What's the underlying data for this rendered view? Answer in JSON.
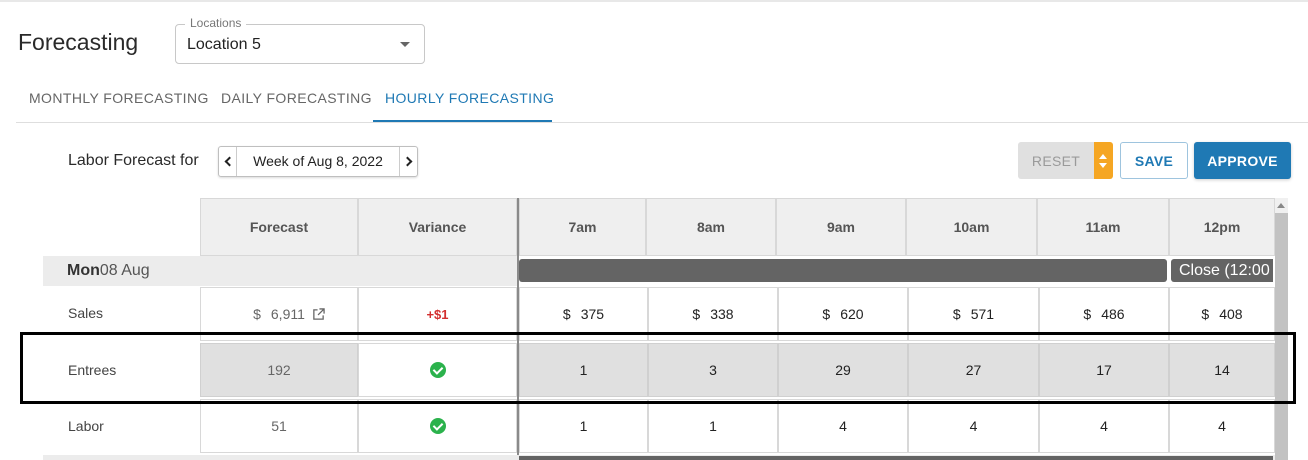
{
  "page": {
    "title": "Forecasting"
  },
  "location": {
    "legend": "Locations",
    "value": "Location 5"
  },
  "tabs": [
    {
      "label": "MONTHLY FORECASTING",
      "active": false
    },
    {
      "label": "DAILY FORECASTING",
      "active": false
    },
    {
      "label": "HOURLY FORECASTING",
      "active": true
    }
  ],
  "toolbar": {
    "label": "Labor Forecast for",
    "week": "Week of Aug 8, 2022",
    "reset_label": "RESET",
    "save_label": "SAVE",
    "approve_label": "APPROVE"
  },
  "grid": {
    "headers": {
      "forecast": "Forecast",
      "variance": "Variance"
    },
    "hours": [
      "7am",
      "8am",
      "9am",
      "10am",
      "11am",
      "12pm"
    ],
    "day": {
      "weekday": "Mon",
      "date": "08 Aug",
      "close_label": "Close (12:00"
    },
    "rows": [
      {
        "label": "Sales",
        "forecast_currency": "$",
        "forecast": "6,911",
        "variance": "+$1",
        "variance_kind": "text",
        "currency": "$",
        "values": [
          "375",
          "338",
          "620",
          "571",
          "486",
          "408"
        ]
      },
      {
        "label": "Entrees",
        "forecast": "192",
        "variance_kind": "check",
        "values": [
          "1",
          "3",
          "29",
          "27",
          "17",
          "14"
        ]
      },
      {
        "label": "Labor",
        "forecast": "51",
        "variance_kind": "check",
        "values": [
          "1",
          "1",
          "4",
          "4",
          "4",
          "4"
        ]
      }
    ]
  },
  "colors": {
    "accent": "#1f79b4",
    "reset_spinner": "#f5a623",
    "positive": "#2bb24c",
    "variance_text": "#d32f2f"
  },
  "icons": {
    "external_link": "external-link-icon",
    "check": "check-circle-icon",
    "location_caret": "caret-down-icon"
  }
}
